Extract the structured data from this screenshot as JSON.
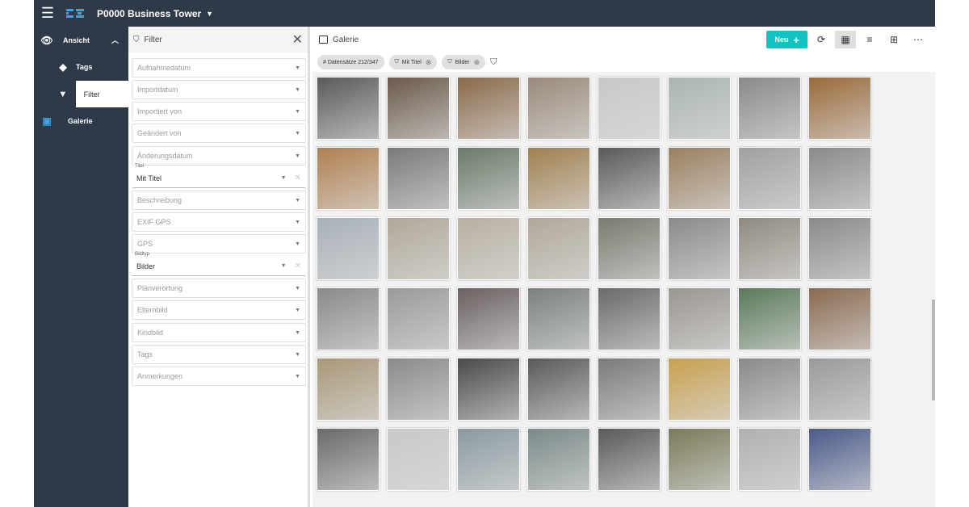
{
  "topbar": {
    "project_title": "P0000 Business Tower",
    "menu_icon": "hamburger-icon",
    "logo": "px-logo"
  },
  "sidenav": {
    "items": [
      {
        "label": "Ansicht",
        "icon": "eye-icon"
      },
      {
        "label": "Tags",
        "icon": "tag-icon"
      },
      {
        "label": "Filter",
        "icon": "filter-icon"
      },
      {
        "label": "Galerie",
        "icon": "image-icon"
      }
    ],
    "active": "Filter"
  },
  "filter_panel": {
    "title": "Filter",
    "fields": [
      {
        "label": "Aufnahmedatum",
        "value": ""
      },
      {
        "label": "Importdatum",
        "value": ""
      },
      {
        "label": "Importiert von",
        "value": ""
      },
      {
        "label": "Geändert von",
        "value": ""
      },
      {
        "label": "Änderungsdatum",
        "value": ""
      },
      {
        "label": "Titel",
        "value": "Mit Titel"
      },
      {
        "label": "Beschreibung",
        "value": ""
      },
      {
        "label": "EXIF GPS",
        "value": ""
      },
      {
        "label": "GPS",
        "value": ""
      },
      {
        "label": "Bildtyp",
        "value": "Bilder"
      },
      {
        "label": "Planverortung",
        "value": ""
      },
      {
        "label": "Elternbild",
        "value": ""
      },
      {
        "label": "Kindbild",
        "value": ""
      },
      {
        "label": "Tags",
        "value": ""
      },
      {
        "label": "Anmerkungen",
        "value": ""
      }
    ]
  },
  "gallery": {
    "title": "Galerie",
    "new_button": "Neu",
    "chips": [
      "# Datensätze 212/347",
      "Mit Titel",
      "Bilder"
    ],
    "thumbnails": [
      [
        "#5a5a5a",
        "#6b5a4a",
        "#8a6a4a",
        "#9a8a7a",
        "#c8c8c8",
        "#aab5b0",
        "#8a8a8a",
        "#9a6a3a"
      ],
      [
        "#b08050",
        "#7a7a7a",
        "#6a7a6a",
        "#a08050",
        "#5a5a5a",
        "#9a8060",
        "#a0a0a0",
        "#8a8a8a"
      ],
      [
        "#a8b0b8",
        "#b0a898",
        "#b8b0a0",
        "#b0a898",
        "#7a7a70",
        "#8a8a88",
        "#908a80",
        "#8a8a88"
      ],
      [
        "#8a8a8a",
        "#9a9a98",
        "#6a6060",
        "#7a8080",
        "#6a6a6a",
        "#9a9690",
        "#5a7a5a",
        "#8a6a50"
      ],
      [
        "#a89878",
        "#8a8a88",
        "#4a4a48",
        "#5a5a58",
        "#7a7a78",
        "#c8a050",
        "#8a8a8a",
        "#9a9a9a"
      ],
      [
        "#6a6a6a",
        "#c8c8c8",
        "#8a9aa0",
        "#7a8a88",
        "#5a5a58",
        "#7a7a5a",
        "#b0b0b0",
        "#4a5a8a"
      ]
    ]
  }
}
